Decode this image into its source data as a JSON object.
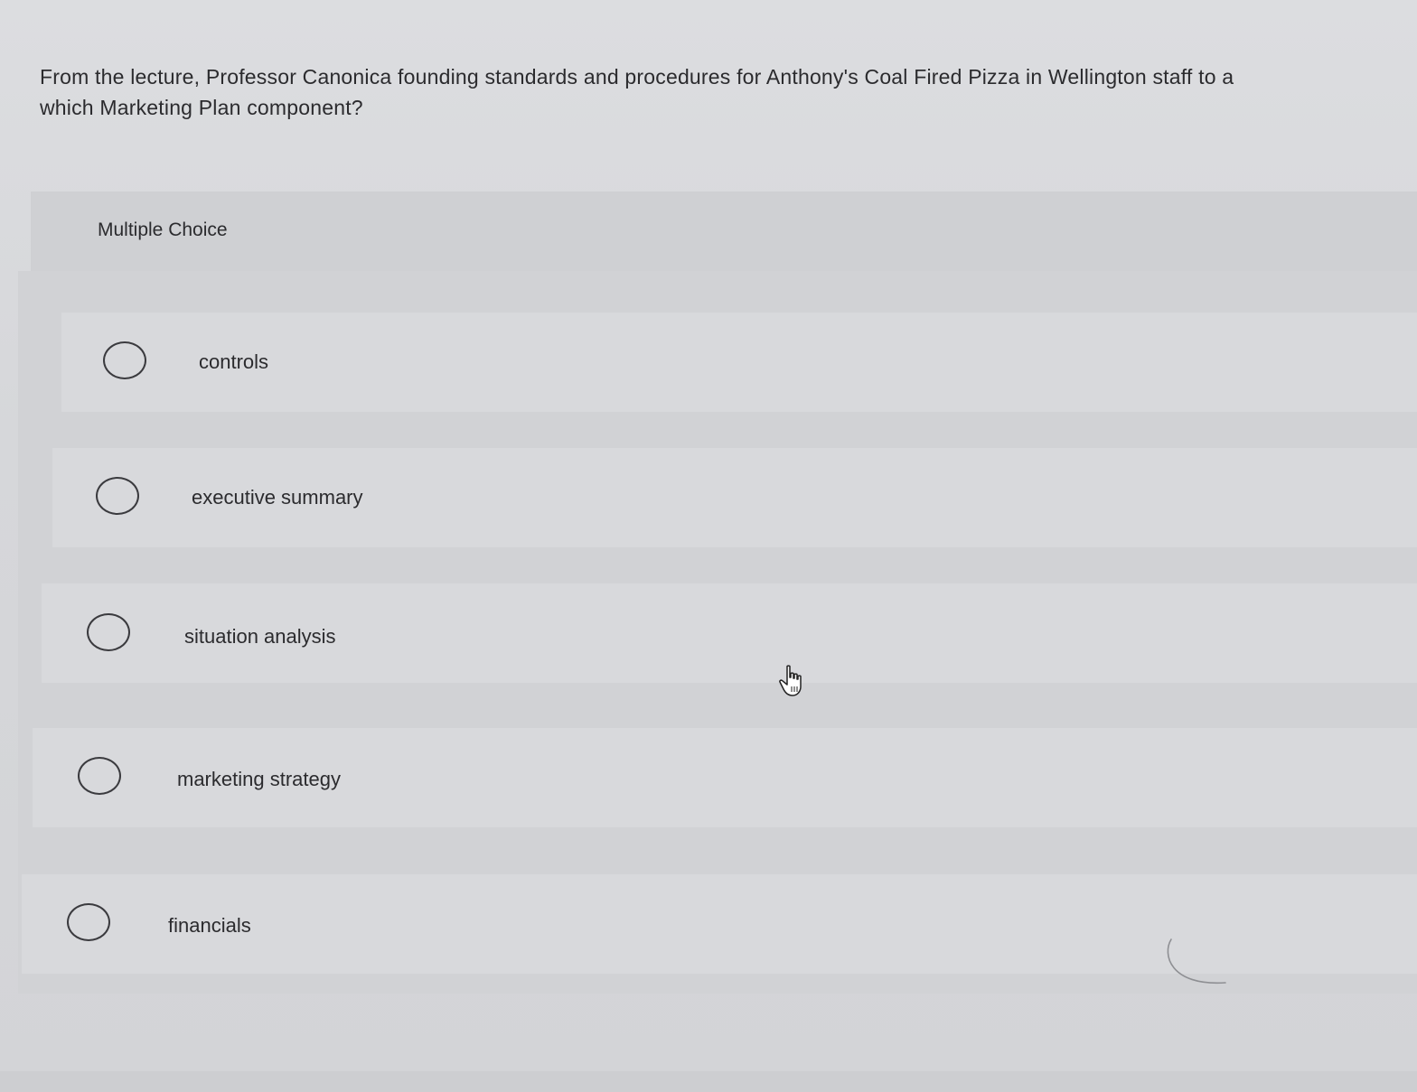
{
  "question": {
    "line1": "From the lecture, Professor Canonica founding standards and procedures for Anthony's Coal Fired Pizza in Wellington staff to a",
    "line2": "which Marketing Plan component?"
  },
  "question_type": "Multiple Choice",
  "options": [
    {
      "label": "controls",
      "selected": false
    },
    {
      "label": "executive summary",
      "selected": false
    },
    {
      "label": "situation analysis",
      "selected": false
    },
    {
      "label": "marketing strategy",
      "selected": false
    },
    {
      "label": "financials",
      "selected": false
    }
  ],
  "icons": {
    "radio": "radio-unselected-icon",
    "pointer": "hand-pointer-icon",
    "loading": "loading-spinner-icon"
  },
  "colors": {
    "text": "#2b2b2e",
    "background": "#d9dadd",
    "radio_border": "#3a3a3e"
  }
}
